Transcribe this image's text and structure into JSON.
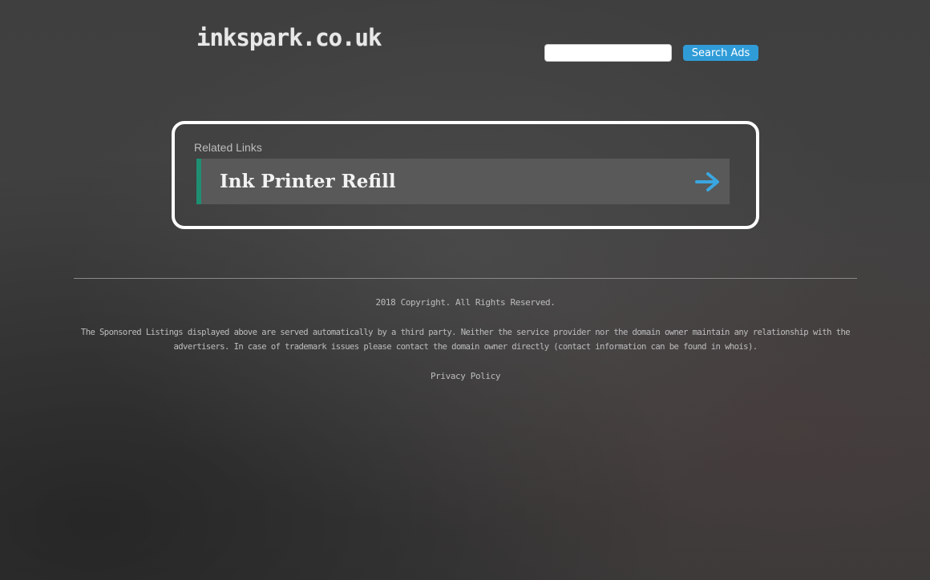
{
  "header": {
    "logo": "inkspark.co.uk",
    "search": {
      "value": "",
      "placeholder": "",
      "button_label": "Search Ads"
    }
  },
  "related_links": {
    "title": "Related Links",
    "items": [
      {
        "label": "Ink Printer Refill",
        "icon": "arrow-right-icon"
      }
    ]
  },
  "footer": {
    "copyright": "2018 Copyright. All Rights Reserved.",
    "disclaimer": "The Sponsored Listings displayed above are served automatically by a third party. Neither the service provider nor the domain owner maintain any relationship with the advertisers. In case of trademark issues please contact the domain owner directly (contact information can be found in whois).",
    "privacy_label": "Privacy Policy"
  },
  "colors": {
    "accent": "#2f9cd8",
    "link_bar": "#1f8f72",
    "link_bg": "#595959"
  }
}
